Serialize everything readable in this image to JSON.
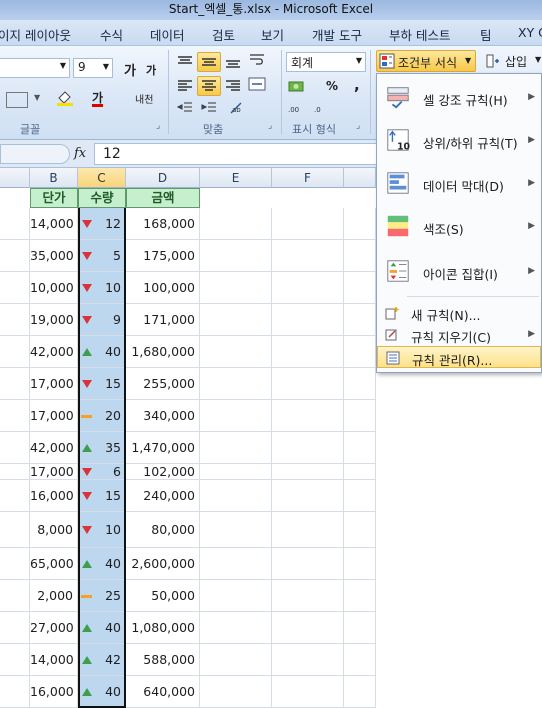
{
  "window": {
    "title": "Start_엑셀_통.xlsx  -  Microsoft Excel"
  },
  "tabs": [
    "이지 레이아웃",
    "수식",
    "데이터",
    "검토",
    "보기",
    "개발 도구",
    "부하 테스트",
    "팀",
    "XY C"
  ],
  "ribbon": {
    "font_size": "9",
    "grow_font": "가",
    "shrink_font": "가",
    "number_format": "회계",
    "conditional_format": "조건부 서식",
    "insert": "삽입",
    "font_color_label": "가",
    "group_font": "글꼴",
    "group_align": "맞춤",
    "group_number": "표시 형식",
    "percent": "%",
    "comma": ",",
    "phonetic": "내천"
  },
  "formula": {
    "fx": "fx",
    "value": "12"
  },
  "columns": [
    "B",
    "C",
    "D",
    "E",
    "F"
  ],
  "table": {
    "headers": [
      "단가",
      "수량",
      "금액"
    ],
    "rows": [
      {
        "price": "14,000",
        "qty": "12",
        "icon": "down",
        "amount": "168,000"
      },
      {
        "price": "35,000",
        "qty": "5",
        "icon": "down",
        "amount": "175,000"
      },
      {
        "price": "10,000",
        "qty": "10",
        "icon": "down",
        "amount": "100,000"
      },
      {
        "price": "19,000",
        "qty": "9",
        "icon": "down",
        "amount": "171,000"
      },
      {
        "price": "42,000",
        "qty": "40",
        "icon": "up",
        "amount": "1,680,000"
      },
      {
        "price": "17,000",
        "qty": "15",
        "icon": "down",
        "amount": "255,000"
      },
      {
        "price": "17,000",
        "qty": "20",
        "icon": "flat",
        "amount": "340,000"
      },
      {
        "price": "42,000",
        "qty": "35",
        "icon": "up",
        "amount": "1,470,000"
      },
      {
        "price": "17,000",
        "qty": "6",
        "icon": "down",
        "amount": "102,000"
      },
      {
        "price": "16,000",
        "qty": "15",
        "icon": "down",
        "amount": "240,000"
      },
      {
        "price": "8,000",
        "qty": "10",
        "icon": "down",
        "amount": "80,000"
      },
      {
        "price": "65,000",
        "qty": "40",
        "icon": "up",
        "amount": "2,600,000"
      },
      {
        "price": "2,000",
        "qty": "25",
        "icon": "flat",
        "amount": "50,000"
      },
      {
        "price": "27,000",
        "qty": "40",
        "icon": "up",
        "amount": "1,080,000"
      },
      {
        "price": "14,000",
        "qty": "42",
        "icon": "up",
        "amount": "588,000"
      },
      {
        "price": "16,000",
        "qty": "40",
        "icon": "up",
        "amount": "640,000"
      }
    ]
  },
  "menu": {
    "items_big": [
      {
        "label": "셀 강조 규칙(H)",
        "icon": "highlight-cells-icon"
      },
      {
        "label": "상위/하위 규칙(T)",
        "icon": "top-bottom-icon"
      },
      {
        "label": "데이터 막대(D)",
        "icon": "data-bars-icon"
      },
      {
        "label": "색조(S)",
        "icon": "color-scales-icon"
      },
      {
        "label": "아이콘 집합(I)",
        "icon": "icon-sets-icon"
      }
    ],
    "items_small": [
      {
        "label": "새 규칙(N)...",
        "icon": "new-rule-icon"
      },
      {
        "label": "규칙 지우기(C)",
        "icon": "clear-rules-icon"
      },
      {
        "label": "규칙 관리(R)...",
        "icon": "manage-rules-icon"
      }
    ]
  },
  "colors": {
    "header_fill": "#c6efce",
    "selected_fill": "#bdd7ee",
    "up": "#3d9e4d",
    "down": "#d9343a",
    "flat": "#f0a22a"
  }
}
